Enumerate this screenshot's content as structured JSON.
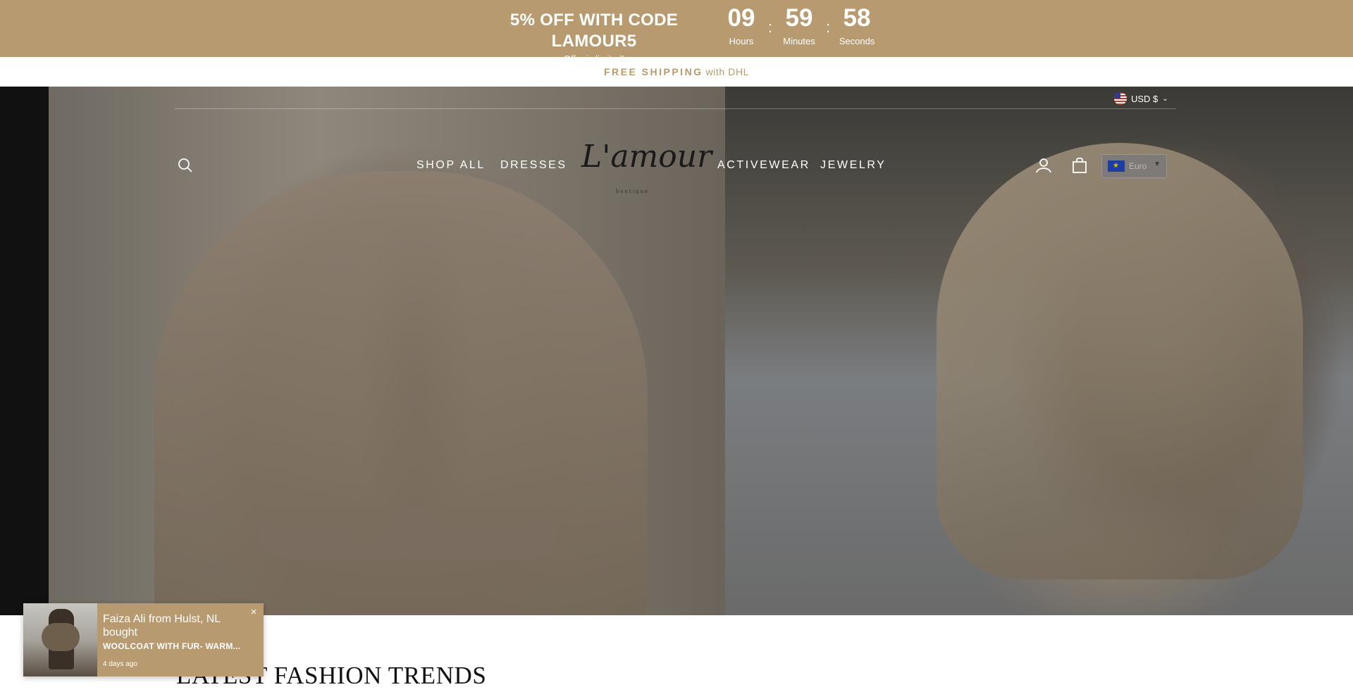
{
  "promo": {
    "code_text": "5% OFF WITH CODE LAMOUR5",
    "sub_text": "Offer is limited!",
    "timer": {
      "hours": "09",
      "hours_label": "Hours",
      "minutes": "59",
      "minutes_label": "Minutes",
      "seconds": "58",
      "seconds_label": "Seconds",
      "separator": ":"
    }
  },
  "shipping": {
    "highlight": "FREE SHIPPING",
    "rest": "with DHL"
  },
  "currency_top": {
    "label": "USD $",
    "icon": "us-flag-icon"
  },
  "nav": {
    "left_links": [
      "SHOP ALL",
      "DRESSES"
    ],
    "right_links": [
      "ACTIVEWEAR",
      "JEWELRY"
    ],
    "logo_text": "L'amour",
    "logo_sub": "boutique",
    "currency_select": "Euro"
  },
  "section": {
    "heading": "LATEST FASHION TRENDS"
  },
  "toast": {
    "name": "Faiza Ali from Hulst, NL bought",
    "product": "WOOLCOAT WITH FUR- WARM...",
    "time": "4 days ago",
    "close": "×"
  },
  "colors": {
    "accent": "#b79a6f",
    "text_dark": "#111111"
  }
}
